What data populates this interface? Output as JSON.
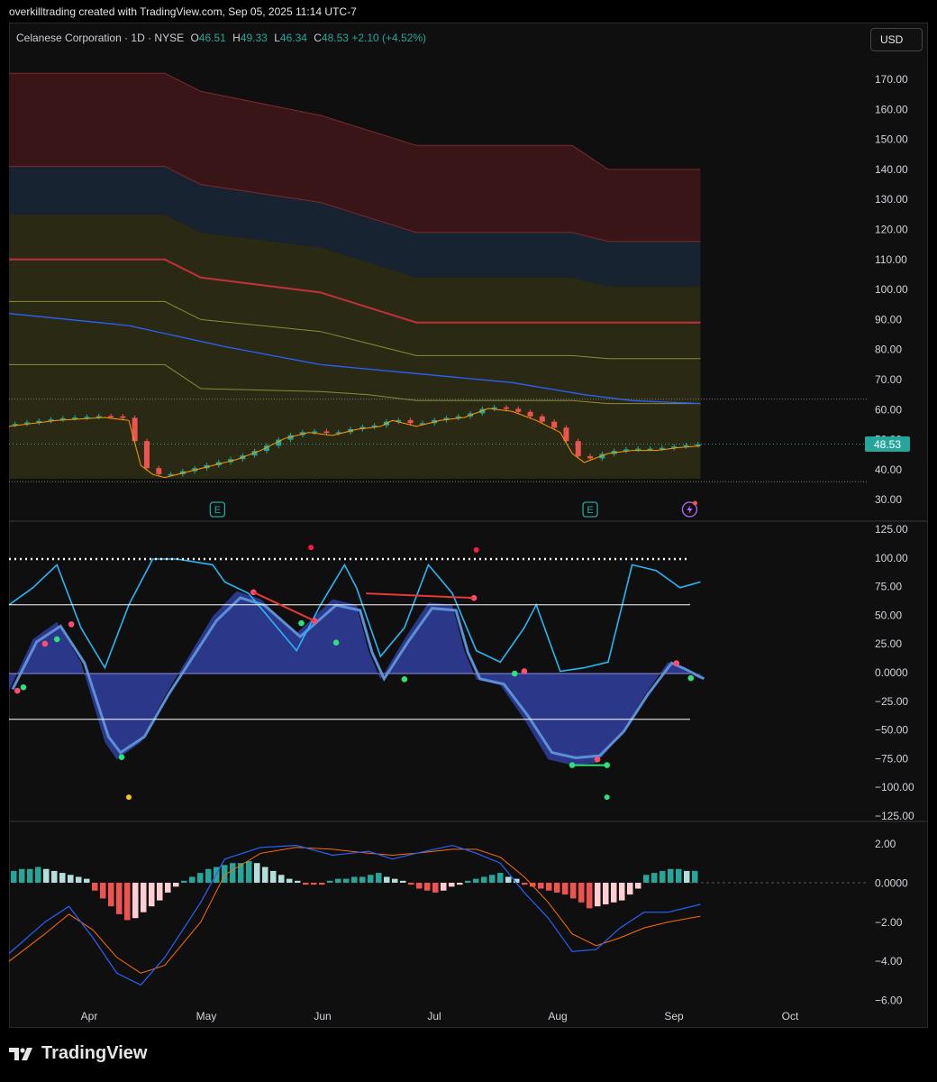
{
  "header": {
    "attribution": "overkilltrading created with TradingView.com, Sep 05, 2025 11:14 UTC-7"
  },
  "legend": {
    "symbol": "Celanese Corporation · 1D · NYSE",
    "o_label": "O",
    "o": "46.51",
    "h_label": "H",
    "h": "49.33",
    "l_label": "L",
    "l": "46.34",
    "c_label": "C",
    "c": "48.53",
    "change": "+2.10 (+4.52%)"
  },
  "currency_button": "USD",
  "last_price": "48.53",
  "brand": "TradingView",
  "colors": {
    "up": "#26a69a",
    "down": "#ef5350",
    "oscillator": "#29b6f6",
    "wave": "#303f9f",
    "macd": "#2962ff",
    "signal": "#ff6d00",
    "band_red": "#3a1518",
    "band_blue": "#172331",
    "band_yellow": "#2a2a14"
  },
  "icons": [
    "earnings-icon",
    "dividend-icon"
  ],
  "chart_data": [
    {
      "type": "candlestick",
      "title": "Celanese Corporation · 1D · NYSE",
      "x_ticks": [
        "Apr",
        "May",
        "Jun",
        "Jul",
        "Aug",
        "Sep",
        "Oct"
      ],
      "y_ticks": [
        "170.00",
        "160.00",
        "150.00",
        "140.00",
        "130.00",
        "120.00",
        "110.00",
        "100.00",
        "90.00",
        "80.00",
        "70.00",
        "60.00",
        "50.00",
        "40.00",
        "30.00"
      ],
      "ylim": [
        30,
        175
      ],
      "close_path": [
        [
          0,
          55
        ],
        [
          4,
          57
        ],
        [
          8,
          58
        ],
        [
          10,
          57
        ],
        [
          11,
          42
        ],
        [
          12,
          39
        ],
        [
          13,
          38
        ],
        [
          16,
          41
        ],
        [
          19,
          44
        ],
        [
          21,
          47
        ],
        [
          23,
          51
        ],
        [
          25,
          53
        ],
        [
          27,
          52
        ],
        [
          29,
          54
        ],
        [
          31,
          55
        ],
        [
          32,
          57
        ],
        [
          34,
          55
        ],
        [
          36,
          57
        ],
        [
          38,
          58
        ],
        [
          40,
          61
        ],
        [
          42,
          60
        ],
        [
          44,
          57
        ],
        [
          46,
          53
        ],
        [
          47,
          46
        ],
        [
          48,
          43
        ],
        [
          50,
          46
        ],
        [
          52,
          47
        ],
        [
          54,
          47
        ],
        [
          56,
          48
        ],
        [
          57.7,
          48.53
        ]
      ],
      "series": [
        {
          "name": "",
          "values": "close_path"
        }
      ],
      "events": [
        "E",
        "E",
        "dividend"
      ]
    },
    {
      "type": "line",
      "y_ticks": [
        "125.00",
        "100.00",
        "75.00",
        "50.00",
        "25.00",
        "0.0000",
        "−25.00",
        "−50.00",
        "−75.00",
        "−100.00",
        "−125.00"
      ],
      "ylim": [
        -125,
        125
      ],
      "reference_lines": [
        100,
        60,
        -40
      ],
      "oscillator": [
        [
          0,
          60
        ],
        [
          2,
          75
        ],
        [
          4,
          95
        ],
        [
          6,
          40
        ],
        [
          8,
          5
        ],
        [
          10,
          60
        ],
        [
          12,
          100
        ],
        [
          14,
          100
        ],
        [
          17,
          95
        ],
        [
          18,
          80
        ],
        [
          20,
          70
        ],
        [
          22,
          45
        ],
        [
          24,
          20
        ],
        [
          26,
          60
        ],
        [
          28,
          95
        ],
        [
          29,
          75
        ],
        [
          31,
          15
        ],
        [
          33,
          40
        ],
        [
          35,
          95
        ],
        [
          37,
          70
        ],
        [
          39,
          20
        ],
        [
          41,
          10
        ],
        [
          43,
          40
        ],
        [
          44,
          60
        ],
        [
          46,
          2
        ],
        [
          48,
          5
        ],
        [
          50,
          10
        ],
        [
          52,
          95
        ],
        [
          54,
          90
        ],
        [
          56,
          75
        ],
        [
          57.7,
          80
        ]
      ],
      "histogram": [
        [
          0,
          -15
        ],
        [
          2,
          30
        ],
        [
          4,
          45
        ],
        [
          6,
          10
        ],
        [
          8,
          -60
        ],
        [
          9,
          -75
        ],
        [
          11,
          -60
        ],
        [
          13,
          -20
        ],
        [
          15,
          15
        ],
        [
          17,
          50
        ],
        [
          19,
          72
        ],
        [
          21,
          65
        ],
        [
          23,
          45
        ],
        [
          24,
          35
        ],
        [
          25,
          45
        ],
        [
          27,
          65
        ],
        [
          29,
          60
        ],
        [
          30,
          20
        ],
        [
          31,
          -5
        ],
        [
          33,
          30
        ],
        [
          35,
          62
        ],
        [
          37,
          60
        ],
        [
          38,
          20
        ],
        [
          39,
          -5
        ],
        [
          41,
          -10
        ],
        [
          43,
          -40
        ],
        [
          45,
          -75
        ],
        [
          47,
          -80
        ],
        [
          49,
          -78
        ],
        [
          51,
          -55
        ],
        [
          53,
          -20
        ],
        [
          55,
          10
        ],
        [
          56,
          5
        ],
        [
          57.7,
          -5
        ]
      ]
    },
    {
      "type": "bar",
      "y_ticks": [
        "2.00",
        "0.0000",
        "−2.00",
        "−4.00",
        "−6.00"
      ],
      "ylim": [
        -6,
        2.5
      ],
      "macd": [
        [
          0,
          -3.6
        ],
        [
          3,
          -2.0
        ],
        [
          5,
          -1.2
        ],
        [
          7,
          -2.8
        ],
        [
          9,
          -4.6
        ],
        [
          11,
          -5.2
        ],
        [
          13,
          -3.8
        ],
        [
          16,
          -1.0
        ],
        [
          18,
          1.2
        ],
        [
          21,
          1.8
        ],
        [
          24,
          1.9
        ],
        [
          27,
          1.4
        ],
        [
          30,
          1.6
        ],
        [
          32,
          1.2
        ],
        [
          34,
          1.5
        ],
        [
          37,
          1.9
        ],
        [
          39,
          1.5
        ],
        [
          41,
          1.0
        ],
        [
          43,
          -0.5
        ],
        [
          45,
          -1.8
        ],
        [
          47,
          -3.5
        ],
        [
          49,
          -3.4
        ],
        [
          51,
          -2.3
        ],
        [
          53,
          -1.5
        ],
        [
          55,
          -1.5
        ],
        [
          57.7,
          -1.1
        ]
      ],
      "signal": [
        [
          0,
          -4.0
        ],
        [
          3,
          -2.6
        ],
        [
          5,
          -1.6
        ],
        [
          7,
          -2.4
        ],
        [
          9,
          -3.8
        ],
        [
          11,
          -4.6
        ],
        [
          13,
          -4.2
        ],
        [
          16,
          -2.0
        ],
        [
          18,
          0.4
        ],
        [
          21,
          1.5
        ],
        [
          24,
          1.8
        ],
        [
          27,
          1.7
        ],
        [
          30,
          1.5
        ],
        [
          32,
          1.4
        ],
        [
          34,
          1.5
        ],
        [
          37,
          1.7
        ],
        [
          39,
          1.7
        ],
        [
          41,
          1.3
        ],
        [
          43,
          0.3
        ],
        [
          45,
          -1.0
        ],
        [
          47,
          -2.6
        ],
        [
          49,
          -3.2
        ],
        [
          51,
          -2.8
        ],
        [
          53,
          -2.3
        ],
        [
          55,
          -2.0
        ],
        [
          57.7,
          -1.7
        ]
      ],
      "hist": [
        0.6,
        0.7,
        0.7,
        0.8,
        0.7,
        0.6,
        0.5,
        0.4,
        0.3,
        0.2,
        -0.4,
        -0.8,
        -1.2,
        -1.6,
        -1.9,
        -1.8,
        -1.5,
        -1.2,
        -0.9,
        -0.5,
        -0.2,
        0.1,
        0.3,
        0.5,
        0.7,
        0.8,
        0.9,
        1.0,
        1.0,
        1.1,
        1.0,
        0.8,
        0.6,
        0.4,
        0.2,
        0.1,
        -0.1,
        -0.1,
        -0.1,
        0.1,
        0.2,
        0.2,
        0.3,
        0.3,
        0.4,
        0.5,
        0.3,
        0.2,
        0.1,
        -0.1,
        -0.3,
        -0.4,
        -0.5,
        -0.4,
        -0.2,
        -0.1,
        0.1,
        0.2,
        0.3,
        0.4,
        0.5,
        0.3,
        0.2,
        -0.1,
        -0.2,
        -0.3,
        -0.4,
        -0.5,
        -0.6,
        -0.8,
        -1.0,
        -1.3,
        -1.2,
        -1.1,
        -1.0,
        -0.9,
        -0.6,
        -0.3,
        0.4,
        0.5,
        0.6,
        0.7,
        0.7,
        0.6,
        0.6
      ]
    }
  ]
}
